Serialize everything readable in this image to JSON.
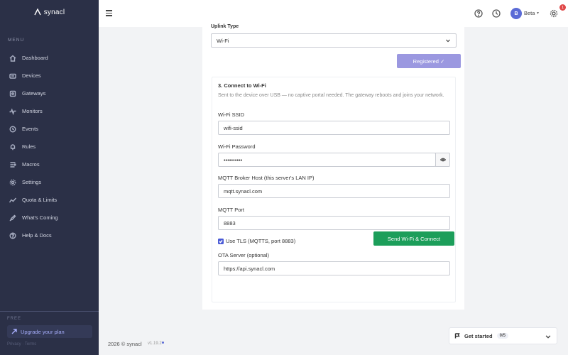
{
  "app": {
    "name": "synacl"
  },
  "sidebar": {
    "section_label": "MENU",
    "items": [
      {
        "label": "Dashboard",
        "icon": "home-icon"
      },
      {
        "label": "Devices",
        "icon": "devices-icon"
      },
      {
        "label": "Gateways",
        "icon": "gateway-icon"
      },
      {
        "label": "Monitors",
        "icon": "pulse-icon"
      },
      {
        "label": "Events",
        "icon": "clock-icon"
      },
      {
        "label": "Rules",
        "icon": "bell-icon"
      },
      {
        "label": "Macros",
        "icon": "macro-icon"
      },
      {
        "label": "Settings",
        "icon": "gear-icon"
      },
      {
        "label": "Quota & Limits",
        "icon": "chart-icon"
      },
      {
        "label": "What's Coming",
        "icon": "rocket-icon"
      },
      {
        "label": "Help & Docs",
        "icon": "help-icon"
      }
    ],
    "plan_label": "FREE",
    "upgrade_label": "Upgrade your plan",
    "footer_text": "Privacy · Terms"
  },
  "header": {
    "user_initial": "B",
    "user_name": "Beta",
    "notification_count": "1"
  },
  "form": {
    "uplink_label": "Uplink Type",
    "uplink_value": "Wi-Fi",
    "registered_label": "Registered ✓",
    "section_title": "3. Connect to Wi-Fi",
    "section_desc": "Sent to the device over USB — no captive portal needed. The gateway reboots and joins your network.",
    "ssid_label": "Wi-Fi SSID",
    "ssid_value": "wifi-ssid",
    "password_label": "Wi-Fi Password",
    "password_value": "••••••••••",
    "mqtt_host_label": "MQTT Broker Host (this server's LAN IP)",
    "mqtt_host_value": "mqtt.synacl.com",
    "mqtt_port_label": "MQTT Port",
    "mqtt_port_value": "8883",
    "tls_label": "Use TLS (MQTTS, port 8883)",
    "tls_checked": true,
    "ota_label": "OTA Server (optional)",
    "ota_value": "https://api.synacl.com",
    "submit_label": "Send Wi-Fi & Connect"
  },
  "footer": {
    "copyright": "2026 © synacl",
    "version": "v1.19.2"
  },
  "get_started": {
    "label": "Get started",
    "progress": "0/5"
  },
  "colors": {
    "sidebar_bg": "#2b3047",
    "primary": "#4a5ad6",
    "success": "#1c9e5a",
    "registered": "#9b98e0"
  }
}
